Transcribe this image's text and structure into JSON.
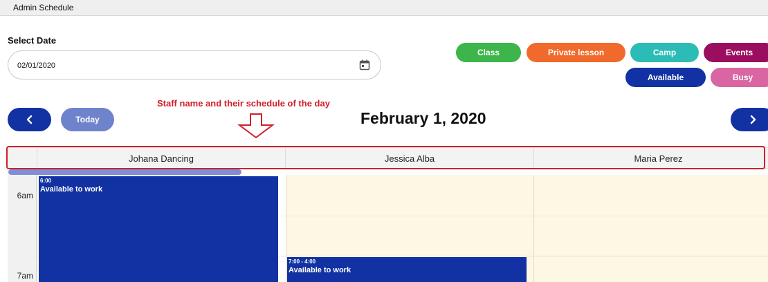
{
  "window": {
    "title": "Admin Schedule"
  },
  "date_picker": {
    "label": "Select Date",
    "value": "02/01/2020",
    "icon": "calendar-icon"
  },
  "legend": [
    {
      "label": "Class",
      "color": "#3cb54a"
    },
    {
      "label": "Private lesson",
      "color": "#f26a2b"
    },
    {
      "label": "Camp",
      "color": "#2bbcb5"
    },
    {
      "label": "Events",
      "color": "#9b0d5e"
    },
    {
      "label": "Available",
      "color": "#1232a3"
    },
    {
      "label": "Busy",
      "color": "#d966a3"
    }
  ],
  "annotation": {
    "text": "Staff name and their schedule of the day",
    "color": "#d0202a"
  },
  "nav": {
    "today_label": "Today",
    "prev_icon": "chevron-left-icon",
    "next_icon": "chevron-right-icon"
  },
  "current_date": "February 1, 2020",
  "staff": [
    {
      "name": "Johana Dancing"
    },
    {
      "name": "Jessica Alba"
    },
    {
      "name": "Maria Perez"
    }
  ],
  "time_labels": [
    "6am",
    "7am"
  ],
  "events": [
    {
      "time": "6:00",
      "title": "Available to work"
    },
    {
      "time": "7:00 - 4:00",
      "title": "Available to work"
    }
  ]
}
